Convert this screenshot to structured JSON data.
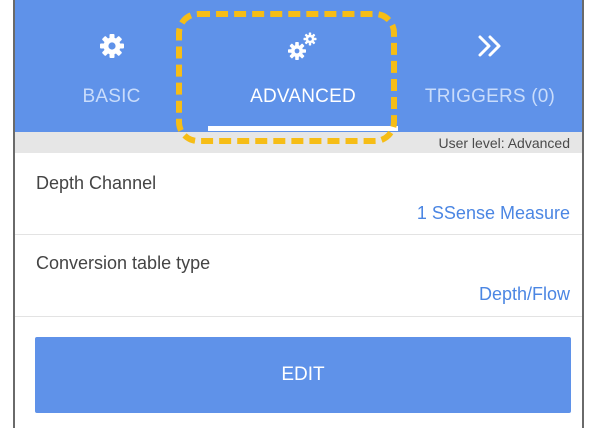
{
  "colors": {
    "tabbar_bg": "#5f92e9",
    "highlight_dash": "#f6bd16",
    "value_text": "#4b86e3",
    "edit_button_bg": "#5f92e9"
  },
  "tabs": [
    {
      "label": "BASIC",
      "icon": "gear-icon",
      "selected": false
    },
    {
      "label": "ADVANCED",
      "icon": "gears-icon",
      "selected": true
    },
    {
      "label": "TRIGGERS (0)",
      "icon": "double-chevron-right-icon",
      "selected": false
    }
  ],
  "user_level": "User level: Advanced",
  "settings": [
    {
      "title": "Depth Channel",
      "value": "1 SSense Measure"
    },
    {
      "title": "Conversion table type",
      "value": "Depth/Flow"
    }
  ],
  "edit_button": {
    "label": "EDIT"
  }
}
